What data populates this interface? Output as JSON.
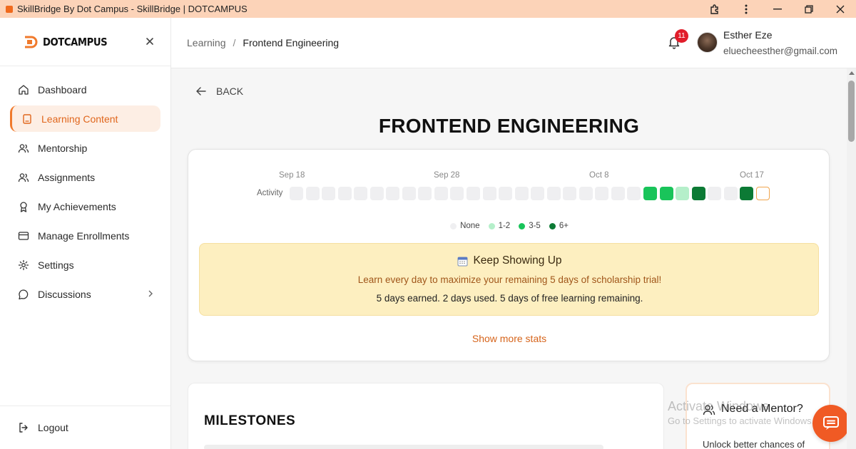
{
  "window": {
    "title": "SkillBridge By Dot Campus - SkillBridge | DOTCAMPUS"
  },
  "sidebar": {
    "logo_text": "DOTCAMPUS",
    "items": [
      {
        "label": "Dashboard",
        "icon": "home-icon",
        "active": false
      },
      {
        "label": "Learning Content",
        "icon": "book-icon",
        "active": true
      },
      {
        "label": "Mentorship",
        "icon": "users-icon",
        "active": false
      },
      {
        "label": "Assignments",
        "icon": "users-icon",
        "active": false
      },
      {
        "label": "My Achievements",
        "icon": "award-icon",
        "active": false
      },
      {
        "label": "Manage Enrollments",
        "icon": "card-icon",
        "active": false
      },
      {
        "label": "Settings",
        "icon": "gear-icon",
        "active": false
      },
      {
        "label": "Discussions",
        "icon": "chat-bubble-icon",
        "active": false,
        "has_chevron": true
      }
    ],
    "logout_label": "Logout"
  },
  "header": {
    "breadcrumb": [
      "Learning",
      "Frontend Engineering"
    ],
    "breadcrumb_separator": "/",
    "notification_count": "11",
    "user_name": "Esther Eze",
    "user_email": "eluecheesther@gmail.com"
  },
  "main": {
    "back_label": "BACK",
    "course_title": "FRONTEND ENGINEERING",
    "activity": {
      "row_label": "Activity",
      "months": [
        "Sep 18",
        "Sep 28",
        "Oct 8",
        "Oct 17"
      ],
      "levels": [
        0,
        0,
        0,
        0,
        0,
        0,
        0,
        0,
        0,
        0,
        0,
        0,
        0,
        0,
        0,
        0,
        0,
        0,
        0,
        0,
        0,
        0,
        2,
        2,
        1,
        3,
        0,
        0,
        3,
        "today"
      ],
      "legend": [
        {
          "label": "None",
          "color": "#efeff1"
        },
        {
          "label": "1-2",
          "color": "#b5efca"
        },
        {
          "label": "3-5",
          "color": "#19c45a"
        },
        {
          "label": "6+",
          "color": "#0c7a35"
        }
      ]
    },
    "promo": {
      "title": "Keep Showing Up",
      "subtitle": "Learn every day to maximize your remaining 5 days of scholarship trial!",
      "stats": "5 days earned. 2 days used. 5 days of free learning remaining."
    },
    "show_more_label": "Show more stats",
    "milestones_heading": "MILESTONES",
    "mentor": {
      "heading": "Need a Mentor?",
      "text": "Unlock better chances of"
    }
  },
  "overlay": {
    "watermark_line1": "Activate Windows",
    "watermark_line2": "Go to Settings to activate Windows."
  },
  "colors": {
    "accent": "#f07a2c",
    "titlebar": "#fcd3b8",
    "badge": "#e11d2a",
    "promo_bg": "#fdefc0"
  }
}
